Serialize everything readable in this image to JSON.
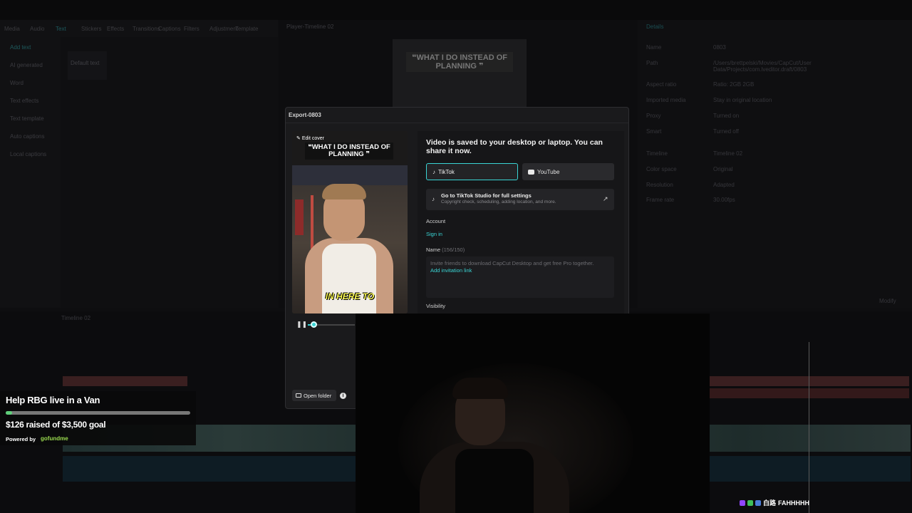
{
  "background_editor": {
    "toolbar_items": [
      "Media",
      "Audio",
      "Text",
      "Stickers",
      "Effects",
      "Transitions",
      "Captions",
      "Filters",
      "Adjustment",
      "Template"
    ],
    "left_nav": [
      "Add text",
      "AI generated",
      "Word",
      "Text effects",
      "Text template",
      "Auto captions",
      "Local captions"
    ],
    "asset_label": "Default text",
    "player_title": "Player-Timeline 02",
    "preview_caption": "❝WHAT I DO INSTEAD OF PLANNING ❞",
    "details_tab": "Details",
    "details": [
      {
        "label": "Name",
        "value": "0803"
      },
      {
        "label": "Path",
        "value": "/Users/brettpelski/Movies/CapCut/User Data/Projects/com.lveditor.draft/0803"
      },
      {
        "label": "Aspect ratio",
        "value": "Ratio: 2GB 2GB"
      },
      {
        "label": "Imported media",
        "value": "Stay in original location"
      },
      {
        "label": "Proxy",
        "value": "Turned on"
      },
      {
        "label": "Smart",
        "value": "Turned off"
      },
      {
        "label": "Timeline",
        "value": "Timeline 02"
      },
      {
        "label": "Color space",
        "value": "Original"
      },
      {
        "label": "Resolution",
        "value": "Adapted"
      },
      {
        "label": "Frame rate",
        "value": "30.00fps"
      }
    ],
    "modify_label": "Modify",
    "timeline_label": "Timeline 02"
  },
  "dialog": {
    "title": "Export-0803",
    "edit_cover": "Edit cover",
    "cover_caption": "❝WHAT I DO INSTEAD OF PLANNING ❞",
    "subtitle": "IN HERE TO",
    "playback_progress": 0.1,
    "saved_message": "Video is saved to your desktop or laptop. You can share it now.",
    "platforms": [
      {
        "label": "TikTok",
        "icon": "tiktok-icon",
        "selected": true
      },
      {
        "label": "YouTube",
        "icon": "youtube-icon",
        "selected": false
      }
    ],
    "studio": {
      "title": "Go to TikTok Studio for full settings",
      "subtitle": "Copyright check, scheduling, adding location, and more."
    },
    "account_label": "Account",
    "signin_label": "Sign in",
    "name_label": "Name",
    "name_count": "(156/150)",
    "name_text": "Invite friends to download CapCut Desktop and get free Pro together.",
    "invite_link": "Add invitation link",
    "visibility_label": "Visibility",
    "open_folder_label": "Open folder",
    "accent": "#3ad5d5"
  },
  "gofundme": {
    "title": "Help RBG live in a Van",
    "raised": "$126 raised of $3,500 goal",
    "progress": 0.036,
    "powered_by": "Powered by",
    "brand": "gofundme"
  },
  "chat": {
    "emote_text": "白路",
    "message": "FAHHHHH"
  }
}
